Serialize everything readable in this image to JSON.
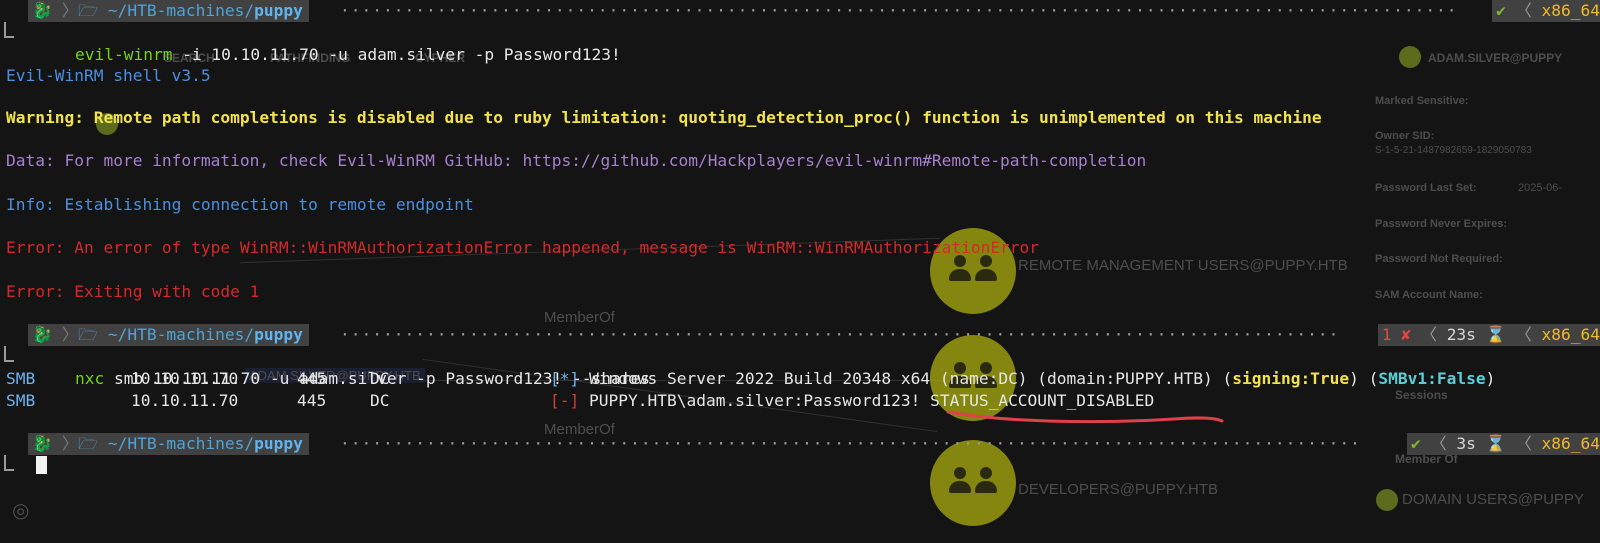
{
  "background": {
    "tabs": [
      "SEARCH",
      "PATHFINDING",
      "CYPHER"
    ],
    "node_header": "ADAM.SILVER@PUPPY",
    "fields": [
      "Marked Sensitive:",
      "Owner SID:",
      "S-1-5-21-1487982659-1829050783",
      "Password Last Set:",
      "2025-06-",
      "Password Never Expires:",
      "Password Not Required:",
      "SAM Account Name:"
    ],
    "node_labels": [
      "REMOTE MANAGEMENT USERS@PUPPY.HTB",
      "DEVELOPERS@PUPPY.HTB"
    ],
    "edge_labels": [
      "MemberOf",
      "MemberOf"
    ],
    "node_small": "ADAM.SILVER@PUPPY.HTB",
    "sessions": "Sessions",
    "member_of": "Member Of",
    "domain_users": "DOMAIN USERS@PUPPY"
  },
  "prompts": [
    {
      "path": "~/HTB-machines/",
      "dir": "puppy",
      "status": "✔",
      "duration": "",
      "arch": "x86_64"
    },
    {
      "path": "~/HTB-machines/",
      "dir": "puppy",
      "status": "1 ✘",
      "duration": "23s ⌛",
      "arch": "x86_64"
    },
    {
      "path": "~/HTB-machines/",
      "dir": "puppy",
      "status": "✔",
      "duration": "3s ⌛",
      "arch": "x86_64"
    }
  ],
  "cmd1": {
    "bin": "evil-winrm",
    "args": " -i 10.10.11.70 -u adam.silver -p Password123!"
  },
  "output1": {
    "banner": "Evil-WinRM shell v3.5",
    "warning": "Warning: Remote path completions is disabled due to ruby limitation: quoting_detection_proc() function is unimplemented on this machine",
    "data": "Data: For more information, check Evil-WinRM GitHub: https://github.com/Hackplayers/evil-winrm#Remote-path-completion",
    "info": "Info: Establishing connection to remote endpoint",
    "error1": "Error: An error of type WinRM::WinRMAuthorizationError happened, message is WinRM::WinRMAuthorizationError",
    "error2": "Error: Exiting with code 1"
  },
  "cmd2": {
    "bin": "nxc",
    "args": " smb 10.10.11.70 -u adam.silver -p Password123! --shares"
  },
  "smb_rows": [
    {
      "proto": "SMB",
      "ip": "10.10.11.70",
      "port": "445",
      "host": "DC",
      "marker": "[*]",
      "msg": "Windows Server 2022 Build 20348 x64 (name:DC) (domain:PUPPY.HTB) (",
      "signing": "signing:True",
      "mid": ") (",
      "smb1": "SMBv1:False",
      "end": ")"
    },
    {
      "proto": "SMB",
      "ip": "10.10.11.70",
      "port": "445",
      "host": "DC",
      "marker": "[-]",
      "msg": "PUPPY.HTB\\adam.silver:Password123! STATUS_ACCOUNT_DISABLED"
    }
  ],
  "annotation_color": "#e0404a"
}
